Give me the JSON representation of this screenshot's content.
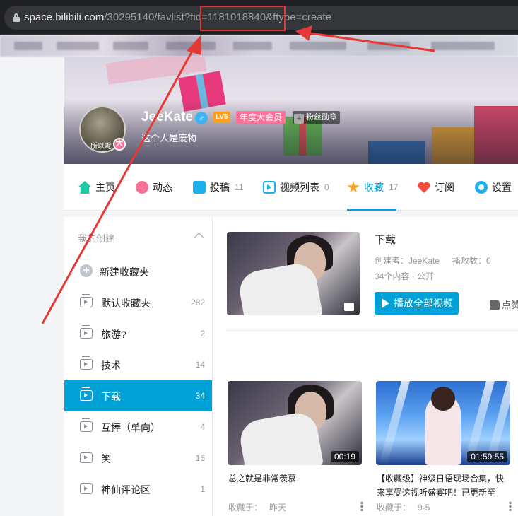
{
  "browser": {
    "url_host": "space.bilibili.com",
    "url_path": "/30295140/favlist?fid=1181018840&ftype=create"
  },
  "profile": {
    "avatar_text": "所以呢",
    "avatar_badge": "大",
    "name": "JeeKate",
    "gender_symbol": "♂",
    "level": "LV5",
    "vip": "年度大会员",
    "fan_badge": "粉丝勋章",
    "sign": "这个人是废物"
  },
  "nav": {
    "items": [
      {
        "label": "主页",
        "count": "",
        "icon": "home-icon"
      },
      {
        "label": "动态",
        "count": "",
        "icon": "dynamic-icon"
      },
      {
        "label": "投稿",
        "count": "11",
        "icon": "upload-icon"
      },
      {
        "label": "视频列表",
        "count": "0",
        "icon": "video-list-icon"
      },
      {
        "label": "收藏",
        "count": "17",
        "icon": "star-icon"
      },
      {
        "label": "订阅",
        "count": "",
        "icon": "heart-icon"
      },
      {
        "label": "设置",
        "count": "",
        "icon": "gear-icon"
      }
    ],
    "active_index": 4
  },
  "sidebar": {
    "header": "我的创建",
    "new_folder": "新建收藏夹",
    "items": [
      {
        "label": "默认收藏夹",
        "count": "282"
      },
      {
        "label": "旅游?",
        "count": "2"
      },
      {
        "label": "技术",
        "count": "14"
      },
      {
        "label": "下载",
        "count": "34"
      },
      {
        "label": "互捧（单向）",
        "count": "4"
      },
      {
        "label": "笑",
        "count": "16"
      },
      {
        "label": "神仙评论区",
        "count": "1"
      }
    ],
    "active_index": 3
  },
  "folder": {
    "title": "下载",
    "creator": "创建者：JeeKate",
    "plays": "播放数：0",
    "info": "34个内容 · 公开",
    "play_all": "播放全部视频",
    "like": "点赞"
  },
  "videos": [
    {
      "duration": "00:19",
      "title": "总之就是非常羡慕",
      "fav_label": "收藏于：",
      "fav_time": "昨天"
    },
    {
      "duration": "01:59:55",
      "title": "【收藏级】神级日语现场合集，快来享受这视听盛宴吧！已更新至",
      "fav_label": "收藏于：",
      "fav_time": "9-5"
    }
  ],
  "colors": {
    "accent": "#00a1d6",
    "vip": "#fb7299",
    "annotation": "#e53935"
  }
}
